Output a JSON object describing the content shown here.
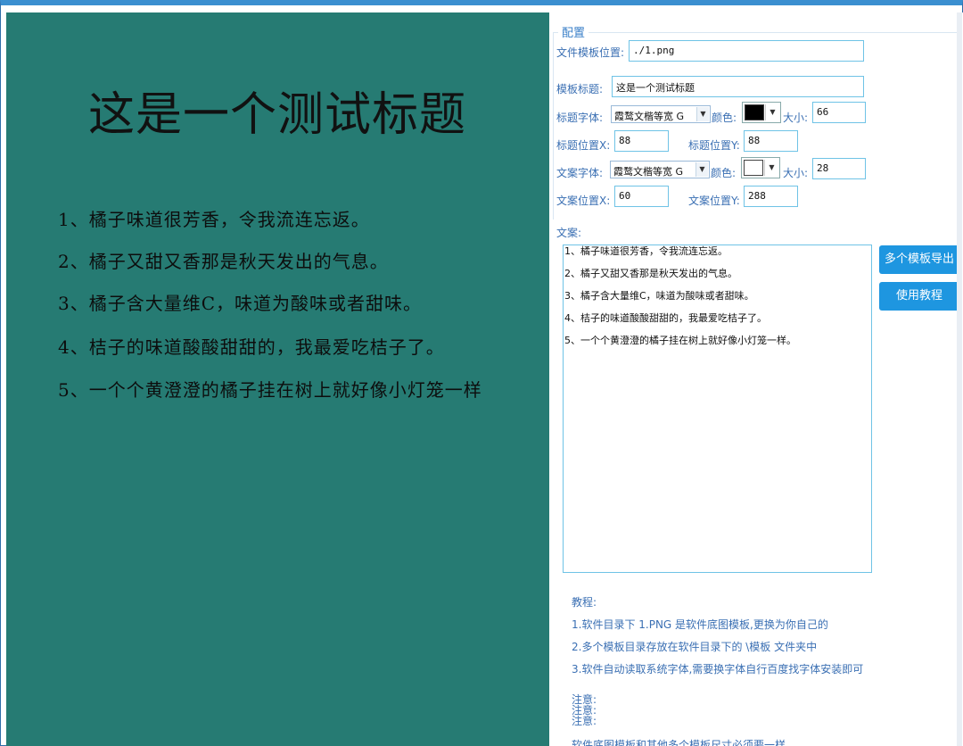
{
  "preview": {
    "title": "这是一个测试标题",
    "lines": [
      "1、橘子味道很芳香，令我流连忘返。",
      "2、橘子又甜又香那是秋天发出的气息。",
      "3、橘子含大量维C，味道为酸味或者甜味。",
      "4、桔子的味道酸酸甜甜的，我最爱吃桔子了。",
      "5、一个个黄澄澄的橘子挂在树上就好像小灯笼一样"
    ],
    "bg_color": "#267b73"
  },
  "config": {
    "legend": "配置",
    "template_path_label": "文件模板位置:",
    "template_path_value": "./1.png",
    "template_title_label": "模板标题:",
    "template_title_value": "这是一个测试标题",
    "title_font_label": "标题字体:",
    "title_font_value": "霞鹜文楷等宽 G",
    "title_color_label": "颜色:",
    "title_color": "#000000",
    "title_size_label": "大小:",
    "title_size_value": "66",
    "title_pos_x_label": "标题位置X:",
    "title_pos_x_value": "88",
    "title_pos_y_label": "标题位置Y:",
    "title_pos_y_value": "88",
    "text_font_label": "文案字体:",
    "text_font_value": "霞鹜文楷等宽 G",
    "text_color_label": "颜色:",
    "text_color": "#ffffff",
    "text_size_label": "大小:",
    "text_size_value": "28",
    "text_pos_x_label": "文案位置X:",
    "text_pos_x_value": "60",
    "text_pos_y_label": "文案位置Y:",
    "text_pos_y_value": "288",
    "copy_label": "文案:",
    "copy_lines": [
      "1、橘子味道很芳香，令我流连忘返。",
      "2、橘子又甜又香那是秋天发出的气息。",
      "3、橘子含大量维C，味道为酸味或者甜味。",
      "4、桔子的味道酸酸甜甜的，我最爱吃桔子了。",
      "5、一个个黄澄澄的橘子挂在树上就好像小灯笼一样。"
    ]
  },
  "buttons": {
    "export_multi": "多个模板导出",
    "tutorial": "使用教程"
  },
  "tutorial": {
    "heading": "教程:",
    "step1": "1.软件目录下 1.PNG 是软件底图模板,更换为你自己的",
    "step2": "2.多个模板目录存放在软件目录下的 \\模板 文件夹中",
    "step3": "3.软件自动读取系统字体,需要换字体自行百度找字体安装即可",
    "note1": "注意:",
    "note2": "注意:",
    "note3": "注意:",
    "note_text": "软件底图模板和其他多个模板尺寸必须要一样"
  },
  "colors": {
    "accent": "#1e96e0",
    "label": "#3a6fb3",
    "field_border": "#6fc3e6"
  }
}
